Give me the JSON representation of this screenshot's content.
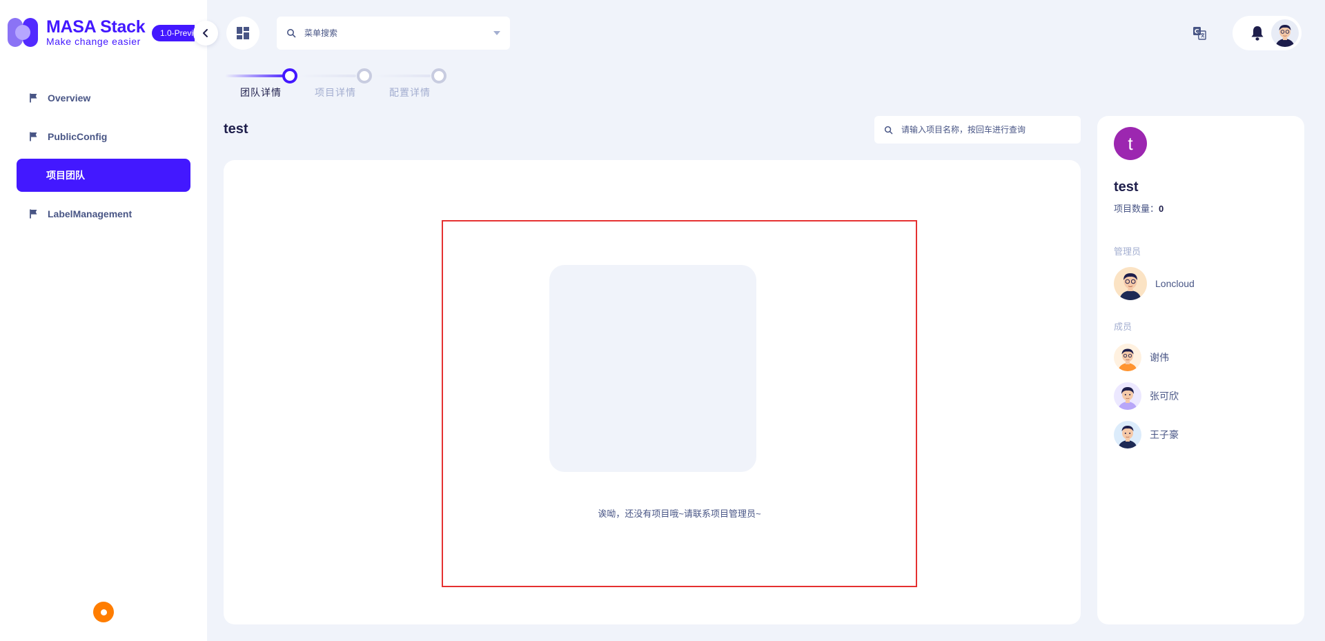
{
  "app": {
    "title": "MASA Stack",
    "subtitle": "Make change easier",
    "version": "1.0-Preview"
  },
  "sidebar": {
    "items": [
      {
        "label": "Overview",
        "icon": "flag-icon",
        "active": false
      },
      {
        "label": "PublicConfig",
        "icon": "flag-icon",
        "active": false
      },
      {
        "label": "项目团队",
        "icon": "",
        "active": true
      },
      {
        "label": "LabelManagement",
        "icon": "flag-icon",
        "active": false
      }
    ]
  },
  "header": {
    "menu_search_placeholder": "菜单搜索"
  },
  "stepper": {
    "steps": [
      {
        "label": "团队详情",
        "active": true
      },
      {
        "label": "项目详情",
        "active": false
      },
      {
        "label": "配置详情",
        "active": false
      }
    ]
  },
  "main": {
    "team_name": "test",
    "project_search_placeholder": "请输入项目名称，按回车进行查询",
    "empty_message": "诶呦，还没有项目哦~请联系项目管理员~"
  },
  "panel": {
    "avatar_letter": "t",
    "team_name": "test",
    "project_count_label": "项目数量：",
    "project_count": "0",
    "admins_label": "管理员",
    "admins": [
      {
        "name": "Loncloud"
      }
    ],
    "members_label": "成员",
    "members": [
      {
        "name": "谢伟"
      },
      {
        "name": "张可欣"
      },
      {
        "name": "王子豪"
      }
    ]
  },
  "colors": {
    "accent": "#4318ff",
    "background": "#f0f3fa",
    "team_avatar": "#9c27b0",
    "help_dot": "#ff7d00",
    "highlight": "#e53030"
  }
}
